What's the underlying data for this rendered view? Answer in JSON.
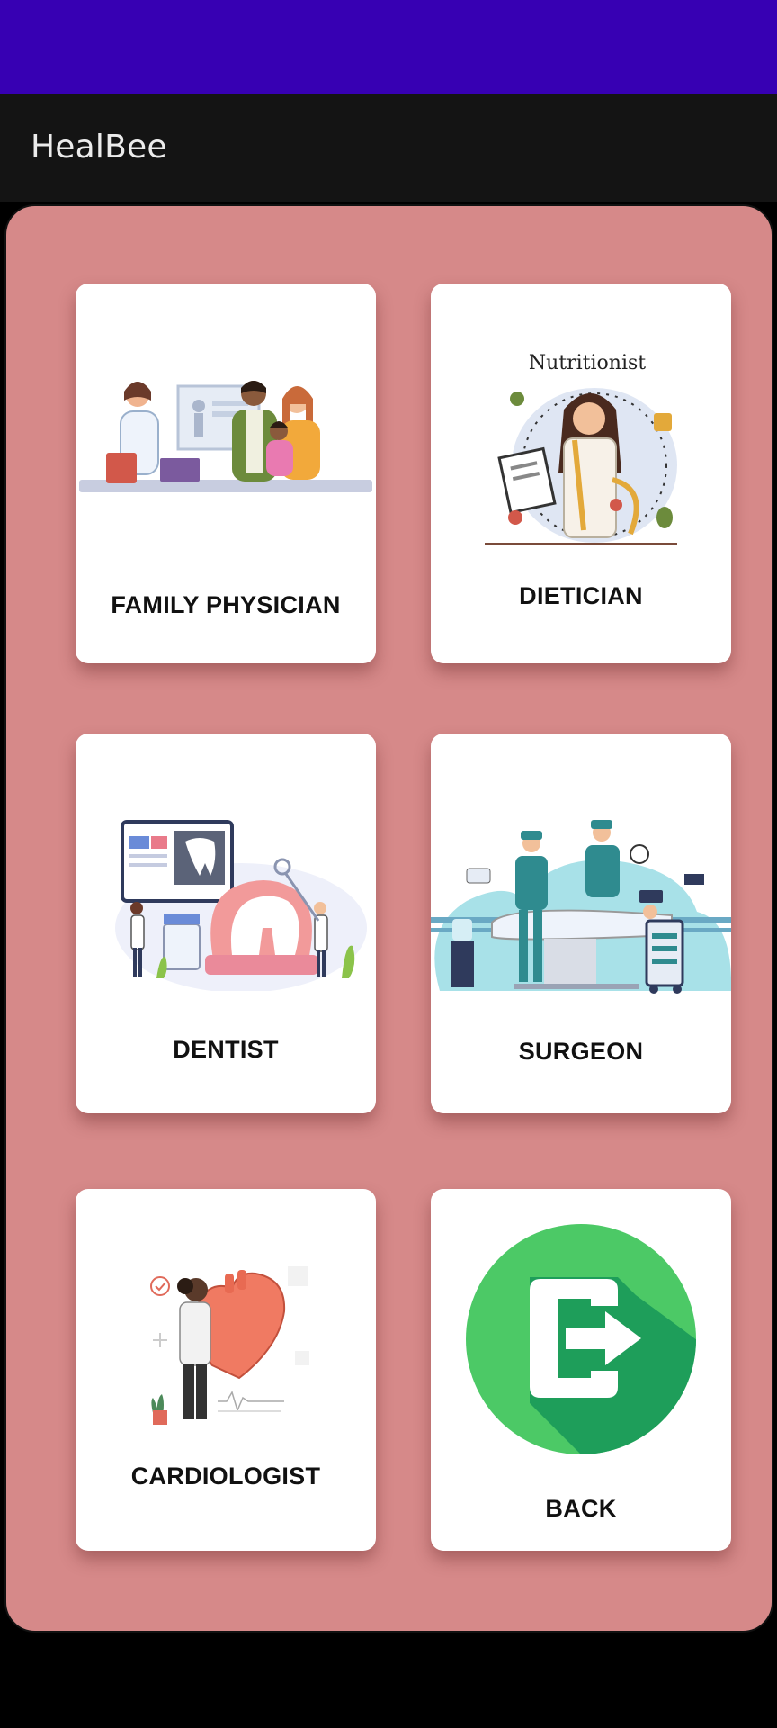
{
  "app": {
    "title": "HealBee"
  },
  "cards": {
    "family": {
      "label": "FAMILY PHYSICIAN",
      "icon": "family-physician-illustration"
    },
    "dietician": {
      "label": "DIETICIAN",
      "icon": "nutritionist-illustration",
      "caption": "Nutritionist"
    },
    "dentist": {
      "label": "DENTIST",
      "icon": "dentist-illustration"
    },
    "surgeon": {
      "label": "SURGEON",
      "icon": "surgeon-illustration"
    },
    "cardiologist": {
      "label": "CARDIOLOGIST",
      "icon": "heart-illustration"
    },
    "back": {
      "label": "BACK",
      "icon": "exit-icon"
    }
  },
  "colors": {
    "status_bar": "#3700B3",
    "app_bar": "#141414",
    "panel": "#D68989",
    "exit_green": "#4CC966",
    "exit_dark_green": "#1E9E5A"
  }
}
